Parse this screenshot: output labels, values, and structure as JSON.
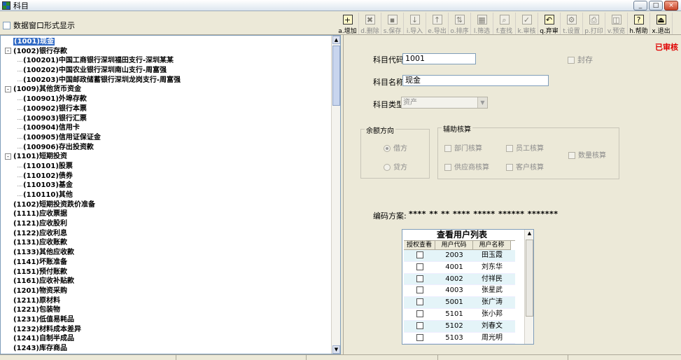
{
  "window": {
    "title": "科目",
    "min": "_",
    "max": "□",
    "close": "×"
  },
  "options": {
    "grid_display_label": "数据窗口形式显示"
  },
  "toolbar": [
    {
      "key": "add",
      "icon": "+",
      "label": "a.增加",
      "enabled": true
    },
    {
      "key": "delete",
      "icon": "✖",
      "label": "d.删除",
      "enabled": false
    },
    {
      "key": "save",
      "icon": "▪",
      "label": "s.保存",
      "enabled": false
    },
    {
      "key": "import",
      "icon": "↓",
      "label": "i.导入",
      "enabled": false
    },
    {
      "key": "export",
      "icon": "↑",
      "label": "e.导出",
      "enabled": false
    },
    {
      "key": "sort",
      "icon": "⇅",
      "label": "o.排序",
      "enabled": false
    },
    {
      "key": "filter",
      "icon": "▦",
      "label": "l.筛选",
      "enabled": false
    },
    {
      "key": "find",
      "icon": "⌕",
      "label": "f.查找",
      "enabled": false
    },
    {
      "key": "audit",
      "icon": "✓",
      "label": "k.审核",
      "enabled": false
    },
    {
      "key": "unaudit",
      "icon": "↶",
      "label": "q.弃审",
      "enabled": true
    },
    {
      "key": "setup",
      "icon": "⚙",
      "label": "t.设置",
      "enabled": false
    },
    {
      "key": "print",
      "icon": "⎙",
      "label": "p.打印",
      "enabled": false
    },
    {
      "key": "preview",
      "icon": "◫",
      "label": "v.预览",
      "enabled": false
    },
    {
      "key": "help",
      "icon": "?",
      "label": "h.帮助",
      "enabled": true
    },
    {
      "key": "exit",
      "icon": "⏏",
      "label": "x.退出",
      "enabled": true
    }
  ],
  "tree": [
    {
      "text": "(1001)现金",
      "level": 0,
      "expand": "",
      "selected": true
    },
    {
      "text": "(1002)银行存款",
      "level": 0,
      "expand": "-"
    },
    {
      "text": "(100201)中国工商银行深圳福田支行-深圳某某",
      "level": 1
    },
    {
      "text": "(100202)中国农业银行深圳南山支行-周富强",
      "level": 1
    },
    {
      "text": "(100203)中国邮政储蓄银行深圳龙岗支行-周富强",
      "level": 1
    },
    {
      "text": "(1009)其他货币资金",
      "level": 0,
      "expand": "-"
    },
    {
      "text": "(100901)外埠存款",
      "level": 1
    },
    {
      "text": "(100902)银行本票",
      "level": 1
    },
    {
      "text": "(100903)银行汇票",
      "level": 1
    },
    {
      "text": "(100904)信用卡",
      "level": 1
    },
    {
      "text": "(100905)信用证保证金",
      "level": 1
    },
    {
      "text": "(100906)存出投资款",
      "level": 1
    },
    {
      "text": "(1101)短期投资",
      "level": 0,
      "expand": "-"
    },
    {
      "text": "(110101)股票",
      "level": 1
    },
    {
      "text": "(110102)债券",
      "level": 1
    },
    {
      "text": "(110103)基金",
      "level": 1
    },
    {
      "text": "(110110)其他",
      "level": 1
    },
    {
      "text": "(1102)短期投资跌价准备",
      "level": 0
    },
    {
      "text": "(1111)应收票据",
      "level": 0
    },
    {
      "text": "(1121)应收股利",
      "level": 0
    },
    {
      "text": "(1122)应收利息",
      "level": 0
    },
    {
      "text": "(1131)应收账款",
      "level": 0
    },
    {
      "text": "(1133)其他应收款",
      "level": 0
    },
    {
      "text": "(1141)坏账准备",
      "level": 0
    },
    {
      "text": "(1151)预付账款",
      "level": 0
    },
    {
      "text": "(1161)应收补贴款",
      "level": 0
    },
    {
      "text": "(1201)物资采购",
      "level": 0
    },
    {
      "text": "(1211)原材料",
      "level": 0
    },
    {
      "text": "(1221)包装物",
      "level": 0
    },
    {
      "text": "(1231)低值易耗品",
      "level": 0
    },
    {
      "text": "(1232)材料成本差异",
      "level": 0
    },
    {
      "text": "(1241)自制半成品",
      "level": 0
    },
    {
      "text": "(1243)库存商品",
      "level": 0
    }
  ],
  "form": {
    "status": "已审核",
    "code_label": "科目代码:",
    "code_value": "1001",
    "name_label": "科目名称:",
    "name_value": "现金",
    "type_label": "科目类型:",
    "type_value": "资产",
    "sealed_label": "封存",
    "balance_group": "余额方向",
    "debit": "借方",
    "credit": "贷方",
    "aux_group": "辅助核算",
    "aux_dept": "部门核算",
    "aux_emp": "员工核算",
    "aux_supplier": "供应商核算",
    "aux_customer": "客户核算",
    "aux_qty": "数量核算",
    "coding_label": "编码方案:",
    "coding_value": "**** ** ** **** ***** ****** *******"
  },
  "user_list": {
    "title": "查看用户列表",
    "headers": [
      "授权查看",
      "用户代码",
      "用户名称"
    ],
    "rows": [
      {
        "code": "2003",
        "name": "田玉霞"
      },
      {
        "code": "4001",
        "name": "刘东华"
      },
      {
        "code": "4002",
        "name": "付祥民"
      },
      {
        "code": "4003",
        "name": "张星武"
      },
      {
        "code": "5001",
        "name": "张广涛"
      },
      {
        "code": "5101",
        "name": "张小邦"
      },
      {
        "code": "5102",
        "name": "刘春文"
      },
      {
        "code": "5103",
        "name": "周光明"
      }
    ]
  }
}
